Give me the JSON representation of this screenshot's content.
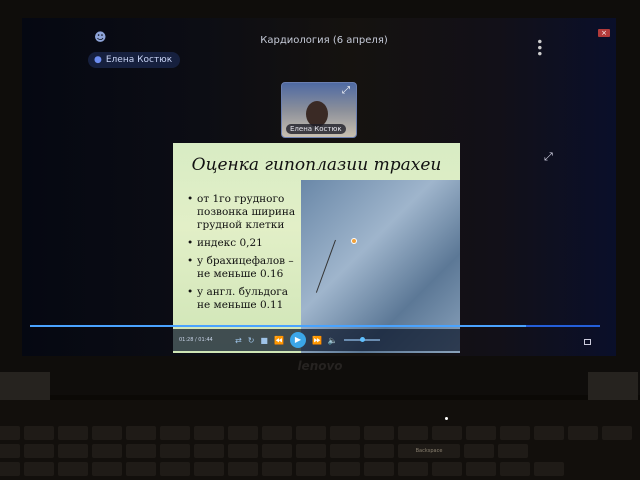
{
  "header": {
    "title": "Кардиология (6 апреля)",
    "speaker": "Елена Костюк"
  },
  "camera": {
    "name": "Елена Костюк"
  },
  "slide": {
    "title": "Оценка гипоплазии трахеи",
    "bullets": [
      "от 1го грудного позвонка ширина грудной клетки",
      "индекс 0,21",
      "у брахицефалов – не меньше 0.16",
      "у англ. бульдога не меньше 0.11"
    ]
  },
  "player": {
    "time": "01:28 / 01:44",
    "progress_percent": 87,
    "volume_percent": 50
  },
  "laptop": {
    "brand": "lenovo",
    "backspace": "Backspace"
  },
  "colors": {
    "accent": "#245fd9",
    "close": "#b23a3a"
  }
}
